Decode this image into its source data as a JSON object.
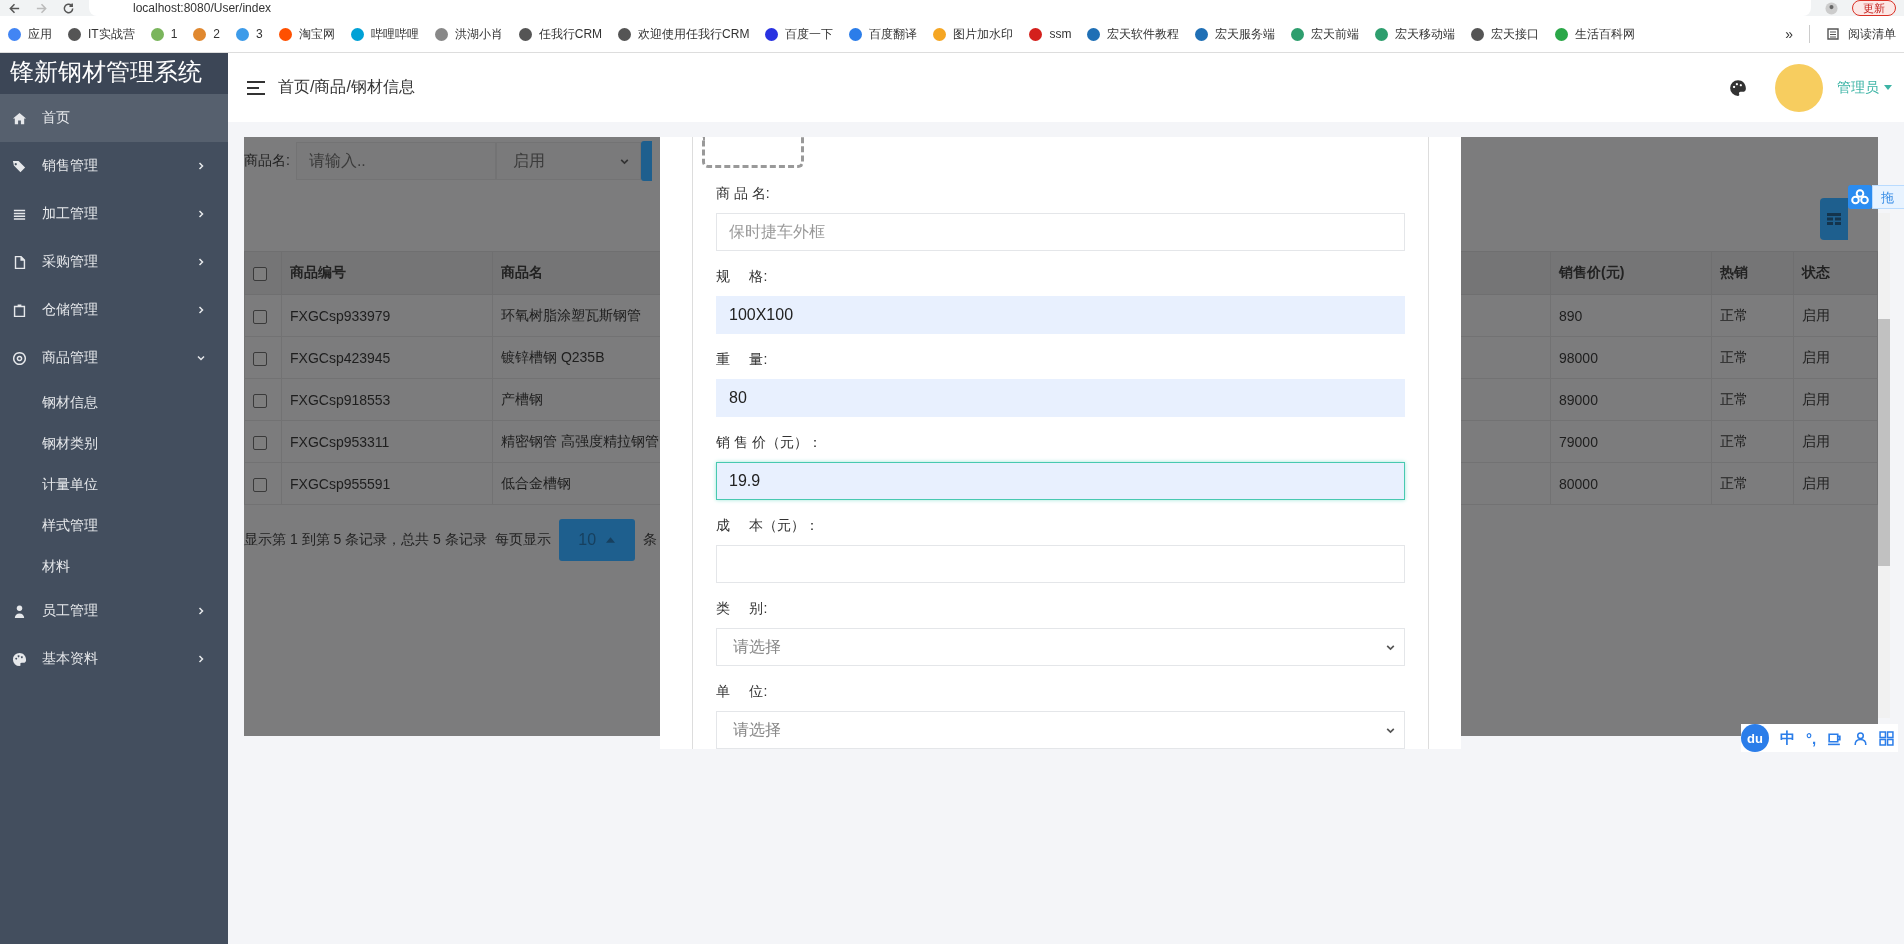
{
  "browser": {
    "address": "localhost:8080/User/index",
    "update_button": "更新",
    "bookmarks": [
      {
        "label": "应用",
        "color": "#4285f4"
      },
      {
        "label": "IT实战营",
        "color": "#555555"
      },
      {
        "label": "1",
        "color": "#7ab55c"
      },
      {
        "label": "2",
        "color": "#e0882f"
      },
      {
        "label": "3",
        "color": "#3d9be9"
      },
      {
        "label": "淘宝网",
        "color": "#ff5000"
      },
      {
        "label": "哔哩哔哩",
        "color": "#00a1d6"
      },
      {
        "label": "洪湖小肖",
        "color": "#888888"
      },
      {
        "label": "任我行CRM",
        "color": "#555555"
      },
      {
        "label": "欢迎使用任我行CRM",
        "color": "#555555"
      },
      {
        "label": "百度一下",
        "color": "#2932e1"
      },
      {
        "label": "百度翻译",
        "color": "#2b7de9"
      },
      {
        "label": "图片加水印",
        "color": "#f5a623"
      },
      {
        "label": "ssm",
        "color": "#d4201c"
      },
      {
        "label": "宏天软件教程",
        "color": "#1f6fb5"
      },
      {
        "label": "宏天服务端",
        "color": "#1f6fb5"
      },
      {
        "label": "宏天前端",
        "color": "#2e9e6e"
      },
      {
        "label": "宏天移动端",
        "color": "#2e9e6e"
      },
      {
        "label": "宏天接口",
        "color": "#555555"
      },
      {
        "label": "生活百科网",
        "color": "#2aa748"
      }
    ],
    "more": "»",
    "reading_list": "阅读清单"
  },
  "sidebar": {
    "title": "锋新钢材管理系统",
    "items": [
      {
        "label": "首页",
        "kind": "link",
        "selected": true
      },
      {
        "label": "销售管理",
        "kind": "group",
        "expanded": false,
        "selected": false
      },
      {
        "label": "加工管理",
        "kind": "group",
        "expanded": false,
        "selected": false
      },
      {
        "label": "采购管理",
        "kind": "group",
        "expanded": false,
        "selected": false
      },
      {
        "label": "仓储管理",
        "kind": "group",
        "expanded": false,
        "selected": false
      },
      {
        "label": "商品管理",
        "kind": "group",
        "expanded": true,
        "selected": false,
        "children": [
          {
            "label": "钢材信息",
            "selected": false
          },
          {
            "label": "钢材类别",
            "selected": false
          },
          {
            "label": "计量单位",
            "selected": false
          },
          {
            "label": "样式管理",
            "selected": false
          },
          {
            "label": "材料",
            "selected": false
          }
        ]
      },
      {
        "label": "员工管理",
        "kind": "group",
        "expanded": false,
        "selected": false
      },
      {
        "label": "基本资料",
        "kind": "group",
        "expanded": false,
        "selected": false
      }
    ]
  },
  "header": {
    "breadcrumb": "首页/商品/钢材信息",
    "user": "管理员"
  },
  "filter": {
    "label": "商品名:",
    "placeholder": "请输入..",
    "status": "启用"
  },
  "table": {
    "all_checked": false,
    "columns": [
      "商品编号",
      "商品名",
      "销售价(元)",
      "热销",
      "状态"
    ],
    "rows": [
      {
        "checked": false,
        "cells": [
          "FXGCsp933979",
          "环氧树脂涂塑瓦斯钢管",
          "890",
          "正常",
          "启用"
        ]
      },
      {
        "checked": false,
        "cells": [
          "FXGCsp423945",
          "镀锌槽钢 Q235B",
          "98000",
          "正常",
          "启用"
        ]
      },
      {
        "checked": false,
        "cells": [
          "FXGCsp918553",
          "产槽钢",
          "89000",
          "正常",
          "启用"
        ]
      },
      {
        "checked": false,
        "cells": [
          "FXGCsp953311",
          "精密钢管 高强度精拉钢管",
          "79000",
          "正常",
          "启用"
        ]
      },
      {
        "checked": false,
        "cells": [
          "FXGCsp955591",
          "低合金槽钢",
          "80000",
          "正常",
          "启用"
        ]
      }
    ]
  },
  "pagination": {
    "summary": "显示第 1 到第 5 条记录，总共 5 条记录",
    "per_page_label": "每页显示",
    "page_size": "10",
    "suffix": "条"
  },
  "dialog": {
    "fields": [
      {
        "label": "商 品 名:",
        "kind": "input",
        "placeholder": "保时捷车外框",
        "autofilled": false,
        "focused": false
      },
      {
        "label": "规     格:",
        "kind": "input",
        "value": "100X100",
        "autofilled": true,
        "focused": false
      },
      {
        "label": "重     量:",
        "kind": "input",
        "value": "80",
        "autofilled": true,
        "focused": false
      },
      {
        "label": "销 售 价（元）：",
        "kind": "input",
        "value": "19.9",
        "autofilled": true,
        "focused": true
      },
      {
        "label": "成     本（元）：",
        "kind": "input",
        "autofilled": false,
        "focused": false
      },
      {
        "label": "类     别:",
        "kind": "select",
        "placeholder": "请选择",
        "focused": false
      },
      {
        "label": "单     位:",
        "kind": "select",
        "placeholder": "请选择",
        "focused": false
      }
    ]
  },
  "netdisk": {
    "label": "拖"
  },
  "ime": {
    "logo": "du",
    "mode": "中",
    "punctuation": "°,"
  }
}
